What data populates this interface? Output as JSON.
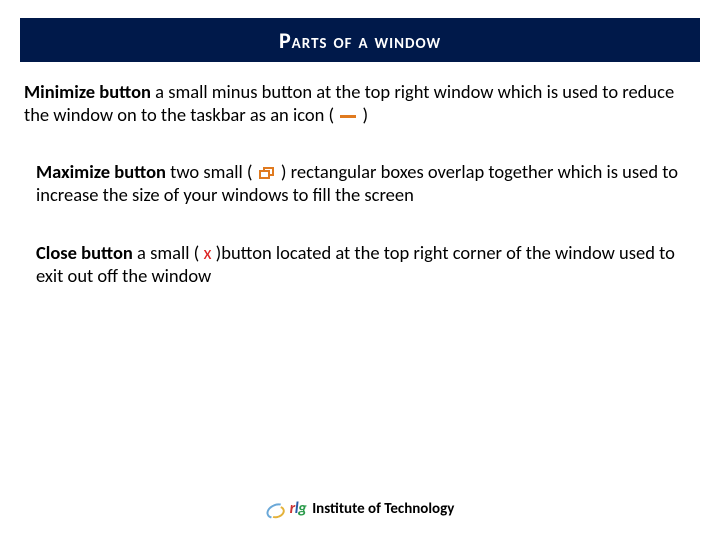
{
  "title": "Parts of a window",
  "para1": {
    "term": "Minimize button",
    "pre": " a small minus button at the top right window which is used to reduce the window on to the taskbar as an icon ( ",
    "post": " )"
  },
  "para2": {
    "term": "Maximize button",
    "pre": " two small ( ",
    "post": " ) rectangular boxes overlap together which is used to increase the size of your windows to fill the screen"
  },
  "para3": {
    "term": "Close button",
    "pre": " a small ( ",
    "x": "x",
    "post": " )button located at the top right corner of the window used to exit out off the window"
  },
  "footer": {
    "r": "r",
    "l": "l",
    "g": "g",
    "label": "Institute of Technology"
  }
}
